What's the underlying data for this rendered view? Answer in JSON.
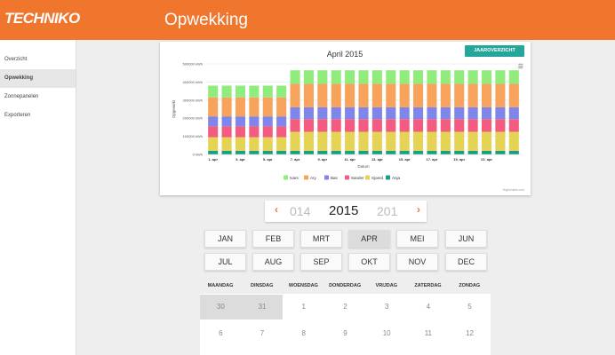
{
  "app": {
    "logo_text": "TECHNIKO",
    "page_title": "Opwekking",
    "accent_color": "#f0752d",
    "button_color": "#26a69a"
  },
  "sidebar": {
    "items": [
      {
        "label": "Overzicht",
        "active": false
      },
      {
        "label": "Opwekking",
        "active": true
      },
      {
        "label": "Zonnepanelen",
        "active": false
      },
      {
        "label": "Exporteren",
        "active": false
      }
    ]
  },
  "chart_card": {
    "button_label": "JAAROVERZICHT",
    "menu_icon": "hamburger-icon",
    "credit": "Highcharts.com"
  },
  "chart_data": {
    "type": "bar",
    "stacked": true,
    "title": "April 2015",
    "xlabel": "Datum",
    "ylabel": "Opgewekt",
    "ylim": [
      0,
      500000
    ],
    "yticks": [
      "0 kWh",
      "100000 kWh",
      "200000 kWh",
      "300000 kWh",
      "400000 kWh",
      "500000 kWh"
    ],
    "ytick_values": [
      0,
      100000,
      200000,
      300000,
      400000,
      500000
    ],
    "categories": [
      "1. apr",
      "2. apr",
      "3. apr",
      "4. apr",
      "5. apr",
      "6. apr",
      "7. apr",
      "8. apr",
      "9. apr",
      "10. apr",
      "11. apr",
      "12. apr",
      "13. apr",
      "14. apr",
      "15. apr",
      "16. apr",
      "17. apr",
      "18. apr",
      "19. apr",
      "20. apr",
      "21. apr",
      "22. apr",
      "23. apr"
    ],
    "tick_labels": [
      "1. apr",
      "3. apr",
      "5. apr",
      "7. apr",
      "9. apr",
      "11. apr",
      "13. apr",
      "15. apr",
      "17. apr",
      "19. apr",
      "21. apr"
    ],
    "series": [
      {
        "name": "Anja",
        "color": "#1a9e86",
        "values": [
          20000,
          20000,
          20000,
          20000,
          20000,
          20000,
          20000,
          20000,
          20000,
          20000,
          20000,
          20000,
          20000,
          20000,
          20000,
          20000,
          20000,
          20000,
          20000,
          20000,
          20000,
          20000,
          20000
        ]
      },
      {
        "name": "Sjoerd",
        "color": "#e4d354",
        "values": [
          75000,
          75000,
          75000,
          75000,
          75000,
          75000,
          105000,
          105000,
          105000,
          105000,
          105000,
          105000,
          105000,
          105000,
          105000,
          105000,
          105000,
          105000,
          105000,
          105000,
          105000,
          105000,
          105000
        ]
      },
      {
        "name": "Sander",
        "color": "#f15c80",
        "values": [
          60000,
          60000,
          60000,
          60000,
          60000,
          60000,
          70000,
          70000,
          70000,
          70000,
          70000,
          70000,
          70000,
          70000,
          70000,
          70000,
          70000,
          70000,
          70000,
          70000,
          70000,
          70000,
          70000
        ]
      },
      {
        "name": "Bas",
        "color": "#8085e9",
        "values": [
          55000,
          55000,
          55000,
          55000,
          55000,
          55000,
          65000,
          65000,
          65000,
          65000,
          65000,
          65000,
          65000,
          65000,
          65000,
          65000,
          65000,
          65000,
          65000,
          65000,
          65000,
          65000,
          65000
        ]
      },
      {
        "name": "Ary",
        "color": "#f7a35c",
        "values": [
          105000,
          105000,
          105000,
          105000,
          105000,
          105000,
          130000,
          130000,
          130000,
          130000,
          130000,
          130000,
          130000,
          130000,
          130000,
          130000,
          130000,
          130000,
          130000,
          130000,
          130000,
          130000,
          130000
        ]
      },
      {
        "name": "Ivars",
        "color": "#90ed7d",
        "values": [
          65000,
          65000,
          65000,
          65000,
          65000,
          65000,
          75000,
          75000,
          75000,
          75000,
          75000,
          75000,
          75000,
          75000,
          75000,
          75000,
          75000,
          75000,
          75000,
          75000,
          75000,
          75000,
          75000
        ]
      }
    ],
    "legend_order": [
      "Ivars",
      "Ary",
      "Bas",
      "Sander",
      "Sjoerd",
      "Anja"
    ],
    "legend_position": "bottom-center",
    "grid": true
  },
  "year_selector": {
    "prev_icon": "chevron-left-icon",
    "next_icon": "chevron-right-icon",
    "prev_year_partial": "014",
    "current_year": "2015",
    "next_year_partial": "201"
  },
  "months": [
    {
      "label": "JAN",
      "active": false
    },
    {
      "label": "FEB",
      "active": false
    },
    {
      "label": "MRT",
      "active": false
    },
    {
      "label": "APR",
      "active": true
    },
    {
      "label": "MEI",
      "active": false
    },
    {
      "label": "JUN",
      "active": false
    },
    {
      "label": "JUL",
      "active": false
    },
    {
      "label": "AUG",
      "active": false
    },
    {
      "label": "SEP",
      "active": false
    },
    {
      "label": "OKT",
      "active": false
    },
    {
      "label": "NOV",
      "active": false
    },
    {
      "label": "DEC",
      "active": false
    }
  ],
  "calendar": {
    "weekdays": [
      "MAANDAG",
      "DINSDAG",
      "WOENSDAG",
      "DONDERDAG",
      "VRIJDAG",
      "ZATERDAG",
      "ZONDAG"
    ],
    "rows": [
      [
        {
          "day": "30",
          "muted": true
        },
        {
          "day": "31",
          "muted": true
        },
        {
          "day": "1",
          "muted": false
        },
        {
          "day": "2",
          "muted": false
        },
        {
          "day": "3",
          "muted": false
        },
        {
          "day": "4",
          "muted": false
        },
        {
          "day": "5",
          "muted": false
        }
      ],
      [
        {
          "day": "6",
          "muted": false
        },
        {
          "day": "7",
          "muted": false
        },
        {
          "day": "8",
          "muted": false
        },
        {
          "day": "9",
          "muted": false
        },
        {
          "day": "10",
          "muted": false
        },
        {
          "day": "11",
          "muted": false
        },
        {
          "day": "12",
          "muted": false
        }
      ]
    ]
  }
}
